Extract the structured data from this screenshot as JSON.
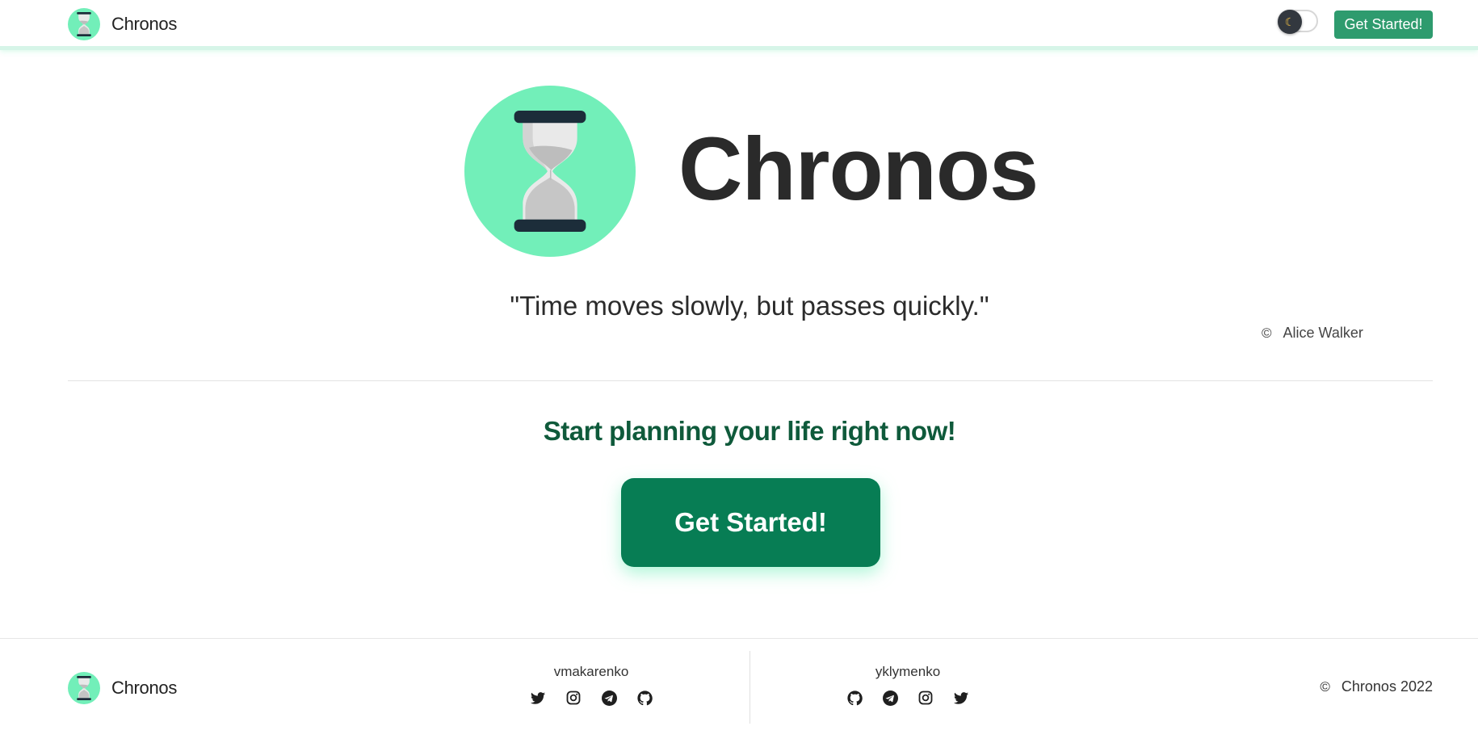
{
  "header": {
    "brand": "Chronos",
    "theme_toggle_icon": "moon-icon",
    "get_started_label": "Get Started!"
  },
  "hero": {
    "title": "Chronos",
    "quote": "\"Time moves slowly, but passes quickly.\"",
    "quote_author": "Alice Walker"
  },
  "cta": {
    "text": "Start planning your life right now!",
    "button_label": "Get Started!"
  },
  "footer": {
    "brand": "Chronos",
    "authors": [
      {
        "name": "vmakarenko",
        "socials": [
          "twitter-icon",
          "instagram-icon",
          "telegram-icon",
          "github-icon"
        ]
      },
      {
        "name": "yklymenko",
        "socials": [
          "github-icon",
          "telegram-icon",
          "instagram-icon",
          "twitter-icon"
        ]
      }
    ],
    "copyright": "Chronos 2022"
  },
  "colors": {
    "mint": "#72efb9",
    "button_dark_green": "#077d54",
    "button_green": "#2e9b6e",
    "cta_text": "#0f5a3b",
    "hourglass_caps": "#1c2d3a"
  }
}
